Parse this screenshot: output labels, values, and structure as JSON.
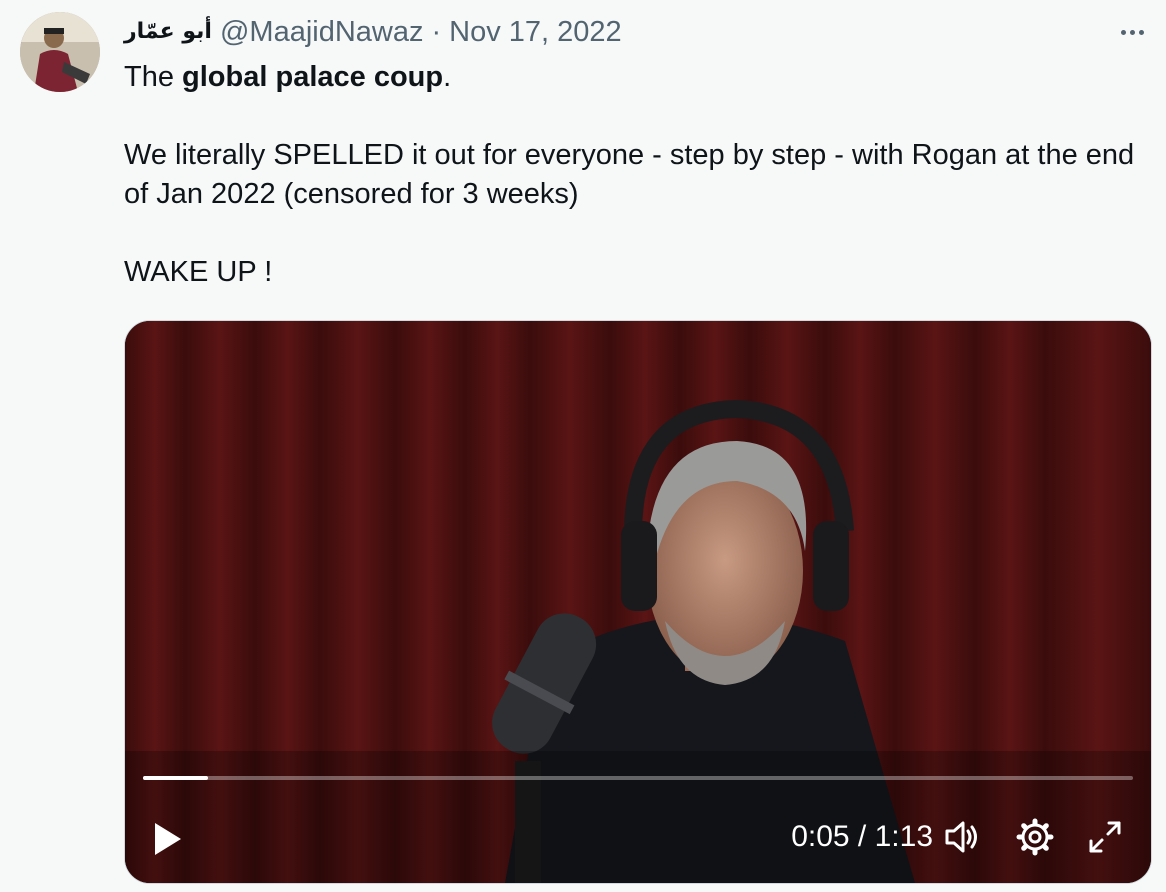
{
  "tweet": {
    "display_name": "أبو عمّار",
    "handle": "@MaajidNawaz",
    "separator": "·",
    "date": "Nov 17, 2022",
    "more_icon": "more-horizontal-icon",
    "text": {
      "line1_before": "The ",
      "line1_bold": "global palace coup",
      "line1_after": ".",
      "para2": "We literally SPELLED it out for everyone - step by step - with Rogan at the end of Jan 2022 (censored for 3 weeks)",
      "para3": "WAKE UP !"
    }
  },
  "video": {
    "current_time": "0:05",
    "time_separator": " / ",
    "duration": "1:13",
    "progress_fraction": 0.066,
    "icons": {
      "play": "play-icon",
      "volume": "volume-icon",
      "settings": "gear-icon",
      "fullscreen": "fullscreen-icon"
    }
  }
}
